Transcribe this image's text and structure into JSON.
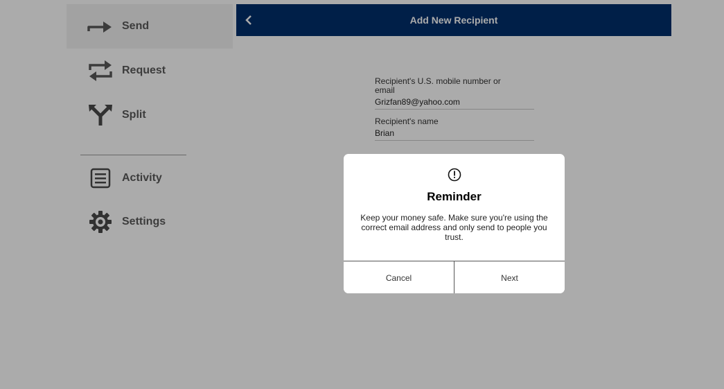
{
  "sidebar": {
    "items": [
      {
        "label": "Send",
        "icon": "arrow-right-icon"
      },
      {
        "label": "Request",
        "icon": "swap-arrows-icon"
      },
      {
        "label": "Split",
        "icon": "split-icon"
      },
      {
        "label": "Activity",
        "icon": "list-icon"
      },
      {
        "label": "Settings",
        "icon": "gear-icon"
      }
    ]
  },
  "header": {
    "title": "Add New Recipient",
    "back_icon": "chevron-left-icon"
  },
  "form": {
    "contact_label": "Recipient's U.S. mobile number or email",
    "contact_value": "Grizfan89@yahoo.com",
    "name_label": "Recipient's name",
    "name_value": "Brian"
  },
  "dialog": {
    "icon": "exclamation-circle-icon",
    "title": "Reminder",
    "message": "Keep your money safe. Make sure you're using the correct email address and only send to people you trust.",
    "cancel_label": "Cancel",
    "next_label": "Next"
  },
  "colors": {
    "header_bg": "#002f6c",
    "overlay": "rgba(0,0,0,0.33)",
    "sidebar_text": "#5a5a5a"
  }
}
